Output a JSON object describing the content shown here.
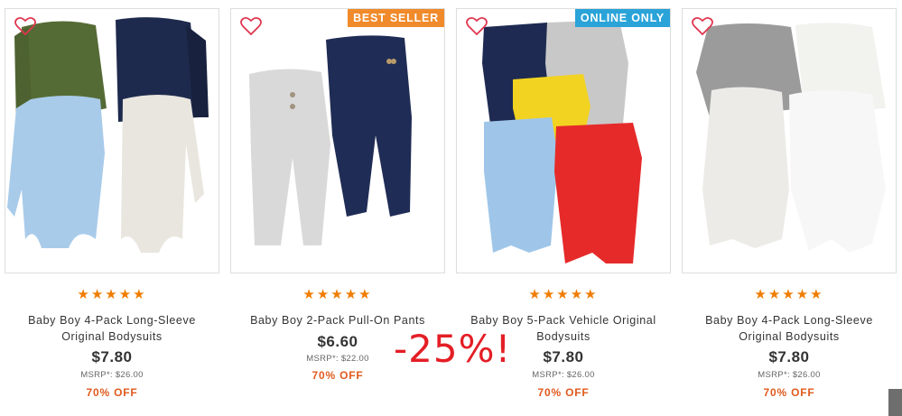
{
  "products": [
    {
      "name": "Baby Boy 4-Pack Long-Sleeve Original Bodysuits",
      "price": "$7.80",
      "msrp": "MSRP*: $26.00",
      "off": "70% OFF",
      "stars": "★★★★★",
      "badge": ""
    },
    {
      "name": "Baby Boy 2-Pack Pull-On Pants",
      "price": "$6.60",
      "msrp": "MSRP*: $22.00",
      "off": "70% OFF",
      "stars": "★★★★★",
      "badge": "BEST SELLER"
    },
    {
      "name": "Baby Boy 5-Pack Vehicle Original Bodysuits",
      "price": "$7.80",
      "msrp": "MSRP*: $26.00",
      "off": "70% OFF",
      "stars": "★★★★★",
      "badge": "ONLINE ONLY"
    },
    {
      "name": "Baby Boy 4-Pack Long-Sleeve Original Bodysuits",
      "price": "$7.80",
      "msrp": "MSRP*: $26.00",
      "off": "70% OFF",
      "stars": "★★★★★",
      "badge": ""
    }
  ],
  "overlay": {
    "discount": "-25%!"
  },
  "colors": {
    "best_seller": "#f08a2a",
    "online_only": "#2aa3d8",
    "stars": "#f07c00",
    "off": "#e05a1e",
    "discount": "#e41e26"
  }
}
